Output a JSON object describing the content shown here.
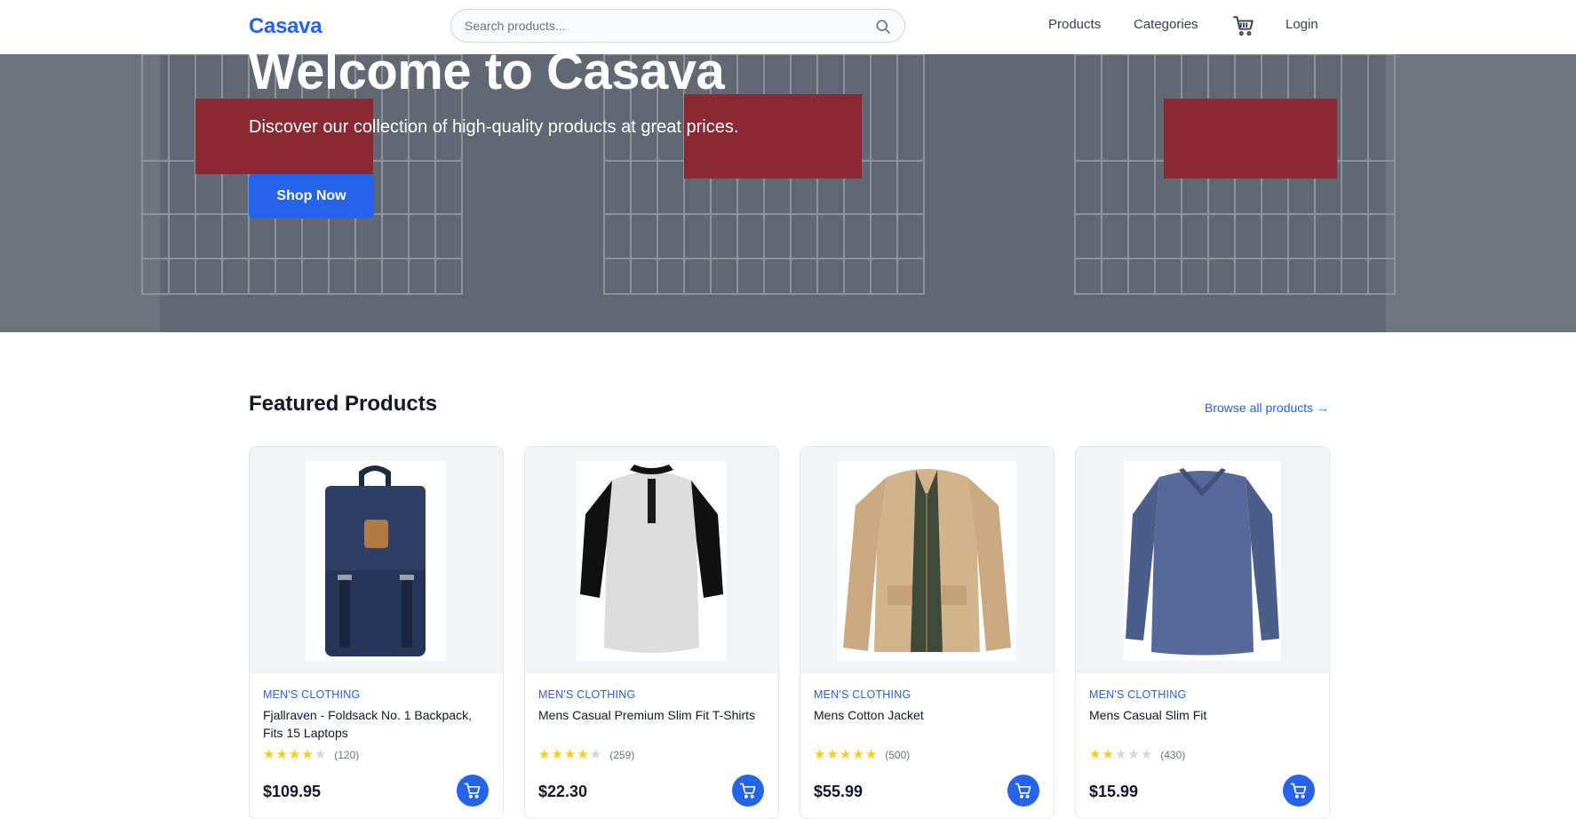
{
  "header": {
    "logo": "Casava",
    "search_placeholder": "Search products...",
    "nav": {
      "products": "Products",
      "categories": "Categories",
      "login": "Login"
    }
  },
  "hero": {
    "title": "Welcome to Casava",
    "subtitle": "Discover our collection of high-quality products at great prices.",
    "cta": "Shop Now"
  },
  "featured": {
    "title": "Featured Products",
    "browse_link": "Browse all products →",
    "products": [
      {
        "category": "MEN'S CLOTHING",
        "title": "Fjallraven - Foldsack No. 1 Backpack, Fits 15 Laptops",
        "rating": 4,
        "count": "(120)",
        "price": "$109.95"
      },
      {
        "category": "MEN'S CLOTHING",
        "title": "Mens Casual Premium Slim Fit T-Shirts",
        "rating": 4,
        "count": "(259)",
        "price": "$22.30"
      },
      {
        "category": "MEN'S CLOTHING",
        "title": "Mens Cotton Jacket",
        "rating": 5,
        "count": "(500)",
        "price": "$55.99"
      },
      {
        "category": "MEN'S CLOTHING",
        "title": "Mens Casual Slim Fit",
        "rating": 2,
        "count": "(430)",
        "price": "$15.99"
      }
    ]
  },
  "colors": {
    "accent": "#2563eb",
    "star_filled": "#facc15",
    "star_empty": "#d1d5db"
  }
}
